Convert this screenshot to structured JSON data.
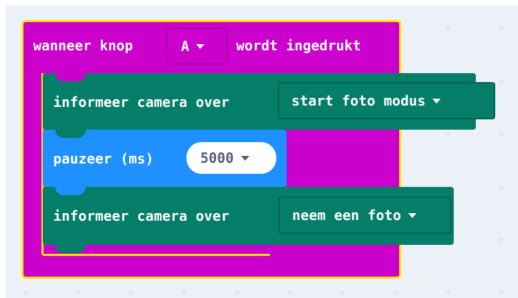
{
  "event_block": {
    "label_prefix": "wanneer knop",
    "button_value": "A",
    "label_suffix": "wordt ingedrukt",
    "color": "#cc00cc",
    "highlight": "#ffe600"
  },
  "camera_block_1": {
    "label": "informeer camera over",
    "value": "start foto modus",
    "color": "#047e68"
  },
  "pause_block": {
    "label": "pauzeer (ms)",
    "value": "5000",
    "color": "#1e90ff"
  },
  "camera_block_2": {
    "label": "informeer camera over",
    "value": "neem een foto",
    "color": "#047e68"
  },
  "icons": {
    "dropdown": "caret-down-icon",
    "grid": "plus-icon"
  }
}
